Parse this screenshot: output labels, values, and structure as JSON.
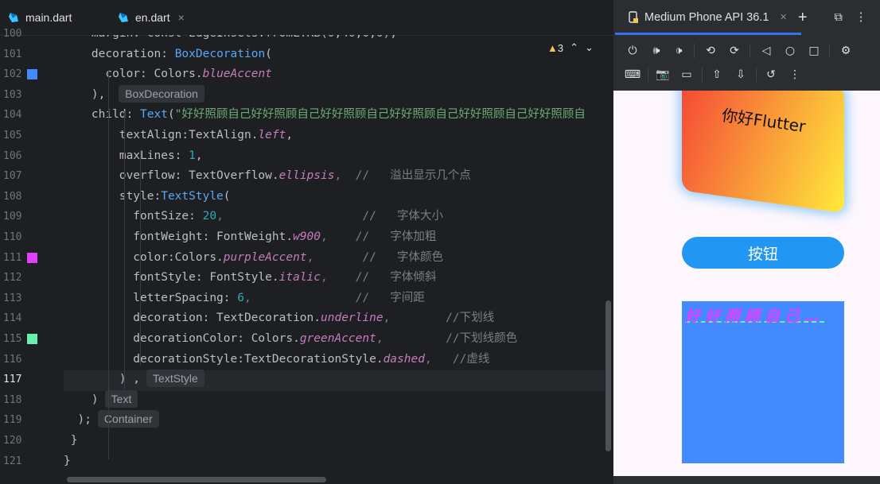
{
  "tabs": [
    {
      "label": "main.dart"
    },
    {
      "label": "en.dart",
      "close": "×"
    }
  ],
  "inspection": {
    "warnings": "3",
    "up": "⌃",
    "down": "⌄"
  },
  "lines": [
    {
      "num": "100",
      "parts": [
        {
          "t": "    margin: const EdgeInsets.fromLTRB(0,40,0,0),",
          "c": ""
        }
      ]
    },
    {
      "num": "101",
      "parts": [
        {
          "t": "    decoration: ",
          "c": ""
        },
        {
          "t": "BoxDecoration",
          "c": "cls"
        },
        {
          "t": "(",
          "c": ""
        }
      ]
    },
    {
      "num": "102",
      "parts": [
        {
          "t": "      color: Colors.",
          "c": ""
        },
        {
          "t": "blueAccent",
          "c": "fld"
        }
      ]
    },
    {
      "num": "103",
      "parts": [
        {
          "t": "    ), ",
          "c": ""
        }
      ],
      "hint": "BoxDecoration"
    },
    {
      "num": "104",
      "parts": [
        {
          "t": "    child: ",
          "c": ""
        },
        {
          "t": "Text",
          "c": "cls"
        },
        {
          "t": "(",
          "c": ""
        },
        {
          "t": "\"好好照顾自己好好照顾自己好好照顾自己好好照顾自己好好照顾自己好好照顾自",
          "c": "str"
        }
      ]
    },
    {
      "num": "105",
      "parts": [
        {
          "t": "        textAlign:TextAlign.",
          "c": ""
        },
        {
          "t": "left",
          "c": "fld"
        },
        {
          "t": ",",
          "c": ""
        }
      ]
    },
    {
      "num": "106",
      "parts": [
        {
          "t": "        maxLines: ",
          "c": ""
        },
        {
          "t": "1",
          "c": "num"
        },
        {
          "t": ",",
          "c": ""
        }
      ]
    },
    {
      "num": "107",
      "parts": [
        {
          "t": "        overflow: TextOverflow.",
          "c": ""
        },
        {
          "t": "ellipsis",
          "c": "fld"
        },
        {
          "t": ",  //   溢出显示几个点",
          "c": "cmt"
        }
      ]
    },
    {
      "num": "108",
      "parts": [
        {
          "t": "        style:",
          "c": ""
        },
        {
          "t": "TextStyle",
          "c": "cls"
        },
        {
          "t": "(",
          "c": ""
        }
      ]
    },
    {
      "num": "109",
      "parts": [
        {
          "t": "          fontSize: ",
          "c": ""
        },
        {
          "t": "20",
          "c": "num"
        },
        {
          "t": ",                    //   字体大小",
          "c": "cmt"
        }
      ]
    },
    {
      "num": "110",
      "parts": [
        {
          "t": "          fontWeight: FontWeight.",
          "c": ""
        },
        {
          "t": "w900",
          "c": "fld"
        },
        {
          "t": ",    //   字体加粗",
          "c": "cmt"
        }
      ]
    },
    {
      "num": "111",
      "parts": [
        {
          "t": "          color:Colors.",
          "c": ""
        },
        {
          "t": "purpleAccent",
          "c": "fld"
        },
        {
          "t": ",       //   字体颜色",
          "c": "cmt"
        }
      ]
    },
    {
      "num": "112",
      "parts": [
        {
          "t": "          fontStyle: FontStyle.",
          "c": ""
        },
        {
          "t": "italic",
          "c": "fld"
        },
        {
          "t": ",    //   字体倾斜",
          "c": "cmt"
        }
      ]
    },
    {
      "num": "113",
      "parts": [
        {
          "t": "          letterSpacing: ",
          "c": ""
        },
        {
          "t": "6",
          "c": "num"
        },
        {
          "t": ",               //   字间距",
          "c": "cmt"
        }
      ]
    },
    {
      "num": "114",
      "parts": [
        {
          "t": "          decoration: TextDecoration.",
          "c": ""
        },
        {
          "t": "underline",
          "c": "fld"
        },
        {
          "t": ",        //下划线",
          "c": "cmt"
        }
      ]
    },
    {
      "num": "115",
      "parts": [
        {
          "t": "          decorationColor: Colors.",
          "c": ""
        },
        {
          "t": "greenAccent",
          "c": "fld"
        },
        {
          "t": ",         //下划线颜色",
          "c": "cmt"
        }
      ]
    },
    {
      "num": "116",
      "parts": [
        {
          "t": "          decorationStyle:TextDecorationStyle.",
          "c": ""
        },
        {
          "t": "dashed",
          "c": "fld"
        },
        {
          "t": ",   //虚线",
          "c": "cmt"
        }
      ]
    },
    {
      "num": "117",
      "parts": [
        {
          "t": "        ) ,",
          "c": ""
        }
      ],
      "hint": "TextStyle",
      "current": true
    },
    {
      "num": "118",
      "parts": [
        {
          "t": "    )",
          "c": ""
        }
      ],
      "hint": "Text"
    },
    {
      "num": "119",
      "parts": [
        {
          "t": "  );",
          "c": ""
        }
      ],
      "hint": "Container"
    },
    {
      "num": "120",
      "parts": [
        {
          "t": " }",
          "c": ""
        }
      ]
    },
    {
      "num": "121",
      "parts": [
        {
          "t": "}",
          "c": ""
        }
      ]
    }
  ],
  "swatches": {
    "102": "#448aff",
    "111": "#e040fb",
    "115": "#69f0ae"
  },
  "device": {
    "title": "Medium Phone API 36.1",
    "close": "×",
    "add": "+"
  },
  "app": {
    "card_text": "你好Flutter",
    "button_label": "按钮",
    "box_text": "好好照顾自己…"
  },
  "colors": {
    "accent": "#3574f0",
    "button": "#2196f3",
    "box": "#448aff",
    "text_purple": "#e040fb",
    "underline_green": "#69f0ae"
  }
}
